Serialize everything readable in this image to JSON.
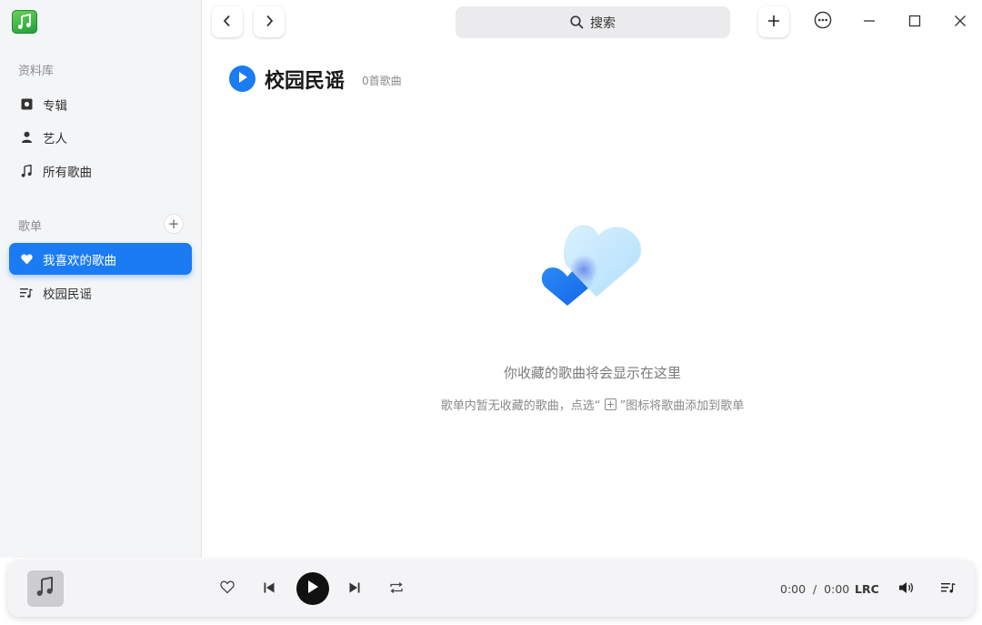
{
  "sidebar": {
    "library_heading": "资料库",
    "library_items": [
      {
        "label": "专辑",
        "icon": "album-icon"
      },
      {
        "label": "艺人",
        "icon": "artist-icon"
      },
      {
        "label": "所有歌曲",
        "icon": "music-note-icon"
      }
    ],
    "playlist_heading": "歌单",
    "playlists": [
      {
        "label": "我喜欢的歌曲",
        "icon": "heart-icon",
        "active": true
      },
      {
        "label": "校园民谣",
        "icon": "playlist-icon",
        "active": false
      }
    ]
  },
  "topbar": {
    "search_label": "搜索"
  },
  "header": {
    "title": "校园民谣",
    "song_count": "0首歌曲"
  },
  "empty_state": {
    "title": "你收藏的歌曲将会显示在这里",
    "hint_before": "歌单内暂无收藏的歌曲，点选“",
    "hint_after": "”图标将歌曲添加到歌单"
  },
  "player": {
    "time": "0:00  /  0:00",
    "lrc_label": "LRC"
  },
  "colors": {
    "accent": "#1a7bf2",
    "sidebar_bg": "#f4f5f7"
  }
}
